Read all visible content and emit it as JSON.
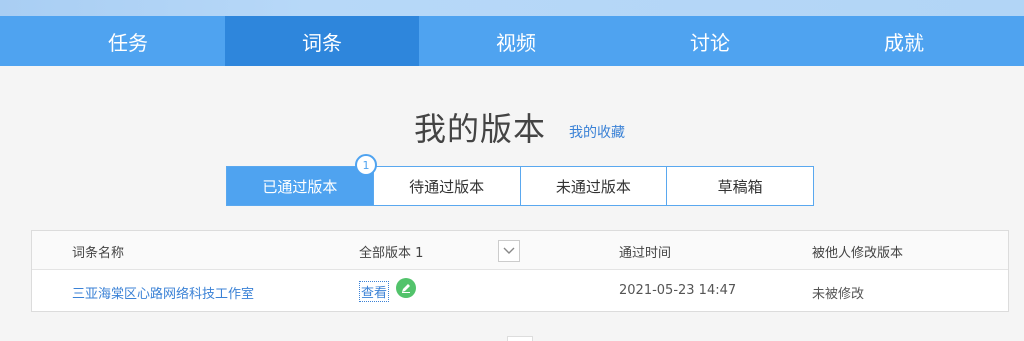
{
  "nav": {
    "items": [
      {
        "label": "任务"
      },
      {
        "label": "词条"
      },
      {
        "label": "视频"
      },
      {
        "label": "讨论"
      },
      {
        "label": "成就"
      }
    ],
    "active_index": 1
  },
  "page": {
    "title": "我的版本",
    "favorites_link": "我的收藏"
  },
  "tabs": {
    "items": [
      {
        "label": "已通过版本"
      },
      {
        "label": "待通过版本"
      },
      {
        "label": "未通过版本"
      },
      {
        "label": "草稿箱"
      }
    ],
    "active_index": 0,
    "badge_count": "1"
  },
  "table": {
    "headers": {
      "name": "词条名称",
      "versions": "全部版本 1",
      "passed_time": "通过时间",
      "modified_by_others": "被他人修改版本"
    },
    "rows": [
      {
        "name": "三亚海棠区心路网络科技工作室",
        "view": "查看",
        "passed_time": "2021-05-23 14:47",
        "modified_by_others": "未被修改"
      }
    ]
  },
  "colors": {
    "nav_bg": "#4fa3f0",
    "nav_active": "#2e86dc",
    "link": "#3b82d6",
    "edit_icon": "#52c36b"
  }
}
